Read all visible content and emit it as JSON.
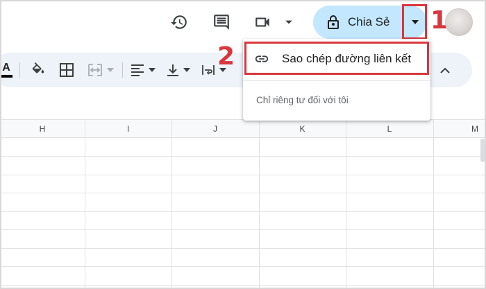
{
  "header": {
    "share_label": "Chia Sẻ",
    "icons": [
      "history-icon",
      "comment-icon",
      "meet-video-icon",
      "lock-icon",
      "dropdown-caret-icon",
      "avatar"
    ]
  },
  "share_menu": {
    "copy_link_label": "Sao chép đường liên kết",
    "access_note": "Chỉ riêng tư đối với tôi"
  },
  "annotations": {
    "step1": "1",
    "step2": "2"
  },
  "toolbar": {
    "text_color_letter": "A"
  },
  "sheet": {
    "columns": [
      "H",
      "I",
      "J",
      "K",
      "L",
      "M"
    ]
  },
  "colors": {
    "accent_share_bg": "#c2e7ff",
    "annotation_red": "#d9363e",
    "toolbar_bg": "#eef2f9"
  }
}
